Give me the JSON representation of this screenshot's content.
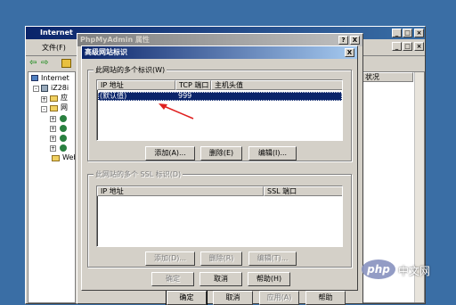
{
  "mmc": {
    "title": "Internet",
    "menu_file": "文件(F)",
    "tree_root": "Internet",
    "tree_server": "iZ28i",
    "tree_app": "应",
    "tree_web": "网",
    "tree_ext": "Web",
    "right_col": "状况"
  },
  "props": {
    "title": "PhpMyAdmin 属性",
    "help_btn": "?",
    "close_btn": "X",
    "ok": "确定",
    "cancel": "取消",
    "apply": "应用(A)",
    "help": "帮助"
  },
  "dialog": {
    "title": "高级网站标识",
    "close_btn": "X",
    "group1_label": "此网站的多个标识(W)",
    "col_ip": "IP 地址",
    "col_port": "TCP 端口",
    "col_host": "主机头值",
    "rows": [
      {
        "ip": "(默认值)",
        "port": "999",
        "host": ""
      }
    ],
    "add": "添加(A)...",
    "remove": "删除(E)",
    "edit": "编辑(I)...",
    "group2_label": "此网站的多个 SSL 标识(D)",
    "ssl_col_ip": "IP 地址",
    "ssl_col_port": "SSL 端口",
    "add2": "添加(D)...",
    "remove2": "删除(R)",
    "edit2": "编辑(T)...",
    "ok": "确定",
    "cancel": "取消",
    "help": "帮助(H)"
  },
  "watermark": "php",
  "watermark_cn": "中文网",
  "colors": {
    "desktop": "#3a6ea5",
    "titlebar_active": "#0a246a",
    "selection": "#0a246a",
    "arrow": "#e02020"
  }
}
